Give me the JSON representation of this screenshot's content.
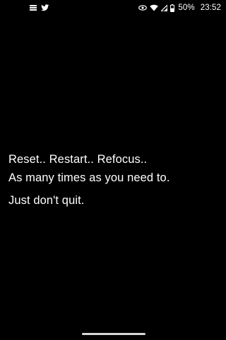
{
  "status_bar": {
    "left_icons": [
      "notification-list-icon",
      "twitter-bird-icon"
    ],
    "right_icons": [
      "eye-icon",
      "wifi-icon",
      "cell-signal-icon",
      "battery-icon"
    ],
    "battery_percent": "50%",
    "time": "23:52"
  },
  "quote": {
    "line1": "Reset.. Restart.. Refocus..",
    "line2": "As many times as you need to.",
    "line3": "Just don't quit."
  },
  "colors": {
    "background": "#000000",
    "text": "#ffffff",
    "home_indicator": "#d8d8d8"
  }
}
